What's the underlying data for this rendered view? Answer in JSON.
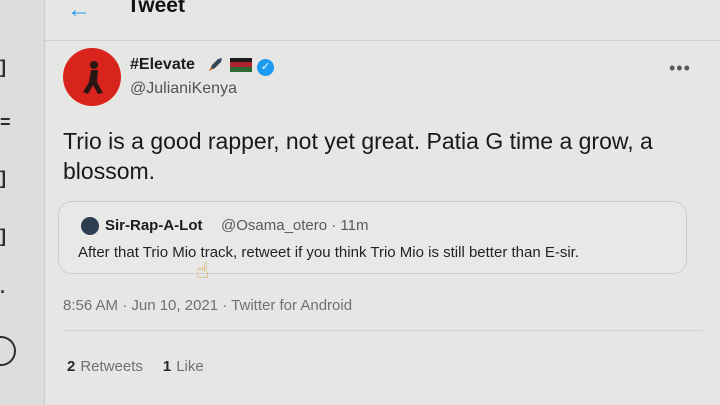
{
  "header": {
    "title": "Tweet"
  },
  "tweet": {
    "author_name": "#Elevate",
    "author_handle": "@JulianiKenya",
    "text": "Trio is a good rapper, not yet great. Patia G time a grow, a blossom.",
    "timestamp": "8:56 AM · Jun 10, 2021 · Twitter for Android",
    "retweets_count": "2",
    "retweets_label": "Retweets",
    "likes_count": "1",
    "likes_label": "Like"
  },
  "quote": {
    "author_name": "Sir-Rap-A-Lot",
    "handle_time": "@Osama_otero · 11m",
    "text": "After that Trio Mio track, retweet if you think Trio Mio is still  better than E-sir."
  },
  "icons": {
    "back": "arrow-left-icon",
    "rocket": "rocket-emoji-icon",
    "flag": "flag-emoji-icon",
    "verified": "verified-badge-icon",
    "more": "more-options-icon",
    "cursor": "hand-pointer-icon"
  },
  "colors": {
    "accent": "#1d9bf0",
    "avatar_bg": "#d9231d"
  }
}
